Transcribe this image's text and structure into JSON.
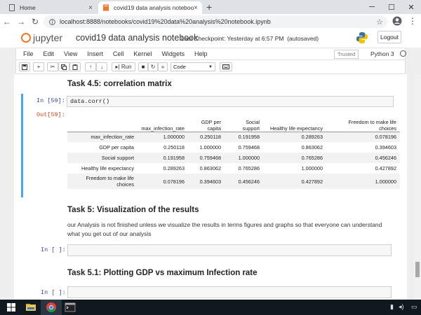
{
  "browser": {
    "tabs": [
      {
        "label": "Home",
        "active": false
      },
      {
        "label": "covid19 data analysis notebook",
        "active": true
      }
    ],
    "url": "localhost:8888/notebooks/covid19%20data%20analysis%20notebook.ipynb"
  },
  "jupyter": {
    "logo_text": "jupyter",
    "notebook_name": "covid19 data analysis notebook",
    "checkpoint": "Last Checkpoint: Yesterday at 6:57 PM",
    "autosaved": "(autosaved)",
    "logout_label": "Logout",
    "menus": [
      "File",
      "Edit",
      "View",
      "Insert",
      "Cell",
      "Kernel",
      "Widgets",
      "Help"
    ],
    "trusted_label": "Trusted",
    "kernel_name": "Python 3",
    "toolbar": {
      "run_label": "Run",
      "cell_type": "Code"
    }
  },
  "notebook": {
    "heading_1": "Task 4.5: correlation matrix",
    "in_prompt_59": "In [59]:",
    "code_59": "data.corr()",
    "out_prompt_59": "Out[59]:",
    "table": {
      "columns": [
        "max_infection_rate",
        "GDP per capita",
        "Social support",
        "Healthy life expectancy",
        "Freedom to make life choices"
      ],
      "rows": [
        {
          "label": "max_infection_rate",
          "values": [
            "1.000000",
            "0.250118",
            "0.191958",
            "0.289263",
            "0.078196"
          ]
        },
        {
          "label": "GDP per capita",
          "values": [
            "0.250118",
            "1.000000",
            "0.759468",
            "0.863062",
            "0.394603"
          ]
        },
        {
          "label": "Social support",
          "values": [
            "0.191958",
            "0.759468",
            "1.000000",
            "0.765286",
            "0.456246"
          ]
        },
        {
          "label": "Healthy life expectancy",
          "values": [
            "0.289263",
            "0.863062",
            "0.765286",
            "1.000000",
            "0.427892"
          ]
        },
        {
          "label": "Freedom to make life choices",
          "values": [
            "0.078196",
            "0.394603",
            "0.456246",
            "0.427892",
            "1.000000"
          ]
        }
      ]
    },
    "heading_2": "Task 5: Visualization of the results",
    "paragraph": "our Analysis is not finished unless we visualize the results in terms figures and graphs so that everyone can understand what you get out of our analysis",
    "empty_prompt": "In [ ]:",
    "heading_3": "Task 5.1: Plotting GDP vs maximum Infection rate"
  },
  "colors": {
    "accent": "#42a5f5",
    "jupyter_orange": "#f37726",
    "taskbar": "#101820"
  }
}
